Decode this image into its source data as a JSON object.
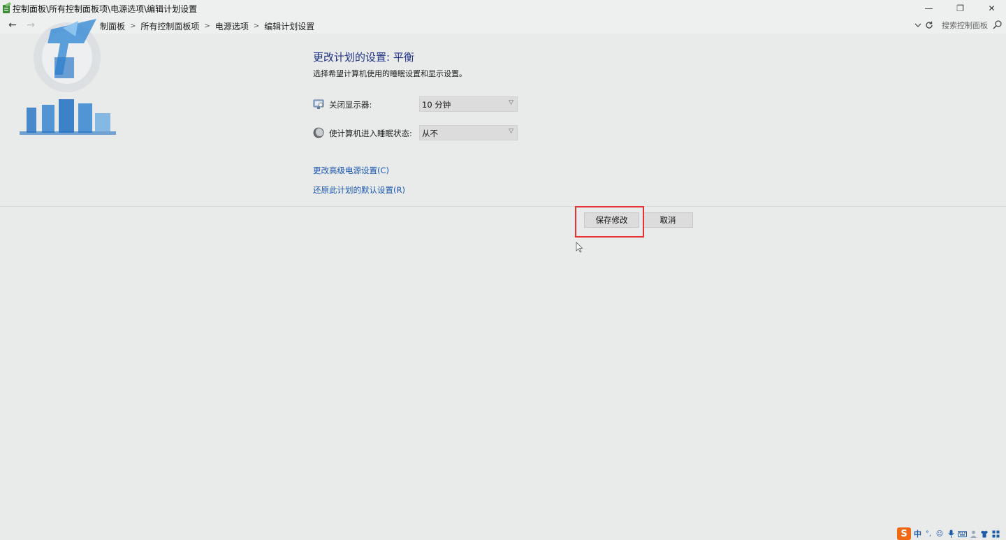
{
  "window": {
    "title": "控制面板\\所有控制面板项\\电源选项\\编辑计划设置",
    "minimize_glyph": "—",
    "maximize_glyph": "❐",
    "close_glyph": "✕"
  },
  "address_bar": {
    "back_glyph": "←",
    "forward_glyph": "→",
    "crumbs": [
      "制面板",
      "所有控制面板项",
      "电源选项",
      "编辑计划设置"
    ],
    "crumb_separator": ">",
    "search_placeholder": "搜索控制面板"
  },
  "content": {
    "title": "更改计划的设置: 平衡",
    "description": "选择希望计算机使用的睡眠设置和显示设置。",
    "settings": [
      {
        "label": "关闭显示器:",
        "value": "10 分钟",
        "icon": "monitor-icon"
      },
      {
        "label": "使计算机进入睡眠状态:",
        "value": "从不",
        "icon": "sleep-moon-icon"
      }
    ],
    "links": {
      "advanced": "更改高级电源设置(C)",
      "restore": "还原此计划的默认设置(R)"
    },
    "buttons": {
      "save": "保存修改",
      "cancel": "取消"
    }
  },
  "tray": {
    "ime_logo": "S",
    "ime_lang": "中"
  },
  "colors": {
    "background": "#e9ebea",
    "title_blue": "#1e3287",
    "link_blue": "#1a56b0",
    "highlight_red": "#e53333",
    "ime_orange": "#f06a16"
  }
}
